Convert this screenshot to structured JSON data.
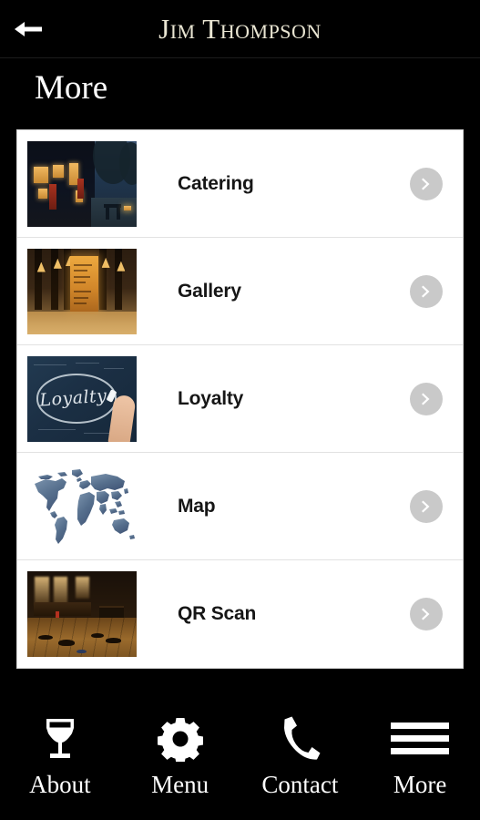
{
  "topbar": {
    "back_icon": "arrow-left-icon",
    "brand": "Jim Thompson"
  },
  "page": {
    "title": "More"
  },
  "list": {
    "chevron_icon": "chevron-right-icon",
    "chevron_circle_color": "#c9c9c9",
    "items": [
      {
        "label": "Catering",
        "thumb": "catering-photo"
      },
      {
        "label": "Gallery",
        "thumb": "gallery-photo"
      },
      {
        "label": "Loyalty",
        "thumb": "loyalty-chalkboard-photo"
      },
      {
        "label": "Map",
        "thumb": "world-map-image"
      },
      {
        "label": "QR Scan",
        "thumb": "qr-scan-interior-photo"
      }
    ]
  },
  "tabbar": {
    "items": [
      {
        "label": "About",
        "icon": "wine-glass-icon"
      },
      {
        "label": "Menu",
        "icon": "gear-icon"
      },
      {
        "label": "Contact",
        "icon": "phone-icon"
      },
      {
        "label": "More",
        "icon": "hamburger-menu-icon"
      }
    ]
  },
  "colors": {
    "background": "#000000",
    "brand_text": "#e9e5d2",
    "card_background": "#ffffff",
    "row_label": "#161616",
    "loyalty_chalk_word": "Loyalty"
  }
}
